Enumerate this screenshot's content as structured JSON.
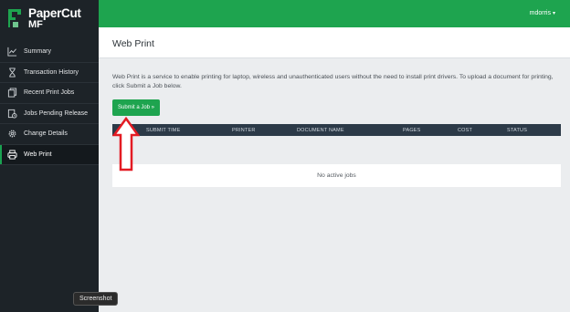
{
  "brand": {
    "name": "PaperCut",
    "sub": "MF"
  },
  "sidebar": {
    "items": [
      {
        "label": "Summary",
        "icon": "chart-icon",
        "active": false
      },
      {
        "label": "Transaction History",
        "icon": "hourglass-icon",
        "active": false
      },
      {
        "label": "Recent Print Jobs",
        "icon": "files-icon",
        "active": false
      },
      {
        "label": "Jobs Pending Release",
        "icon": "pending-jobs-icon",
        "active": false
      },
      {
        "label": "Change Details",
        "icon": "gear-icon",
        "active": false
      },
      {
        "label": "Web Print",
        "icon": "printer-icon",
        "active": true
      }
    ]
  },
  "header": {
    "username": "mdorris",
    "dropdown_icon": "chevron-down-icon"
  },
  "main": {
    "title": "Web Print",
    "description": "Web Print is a service to enable printing for laptop, wireless and unauthenticated users without the need to install print drivers. To upload a document for printing, click Submit a Job below.",
    "submit_label": "Submit a Job »",
    "table": {
      "columns": [
        "SUBMIT TIME",
        "PRINTER",
        "DOCUMENT NAME",
        "PAGES",
        "COST",
        "STATUS"
      ],
      "empty_text": "No active jobs"
    }
  },
  "tooltip": "Screenshot",
  "colors": {
    "accent": "#1ea44f",
    "sidebar": "#1d2328",
    "table_header": "#2c3a48",
    "arrow": "#e31b23"
  }
}
